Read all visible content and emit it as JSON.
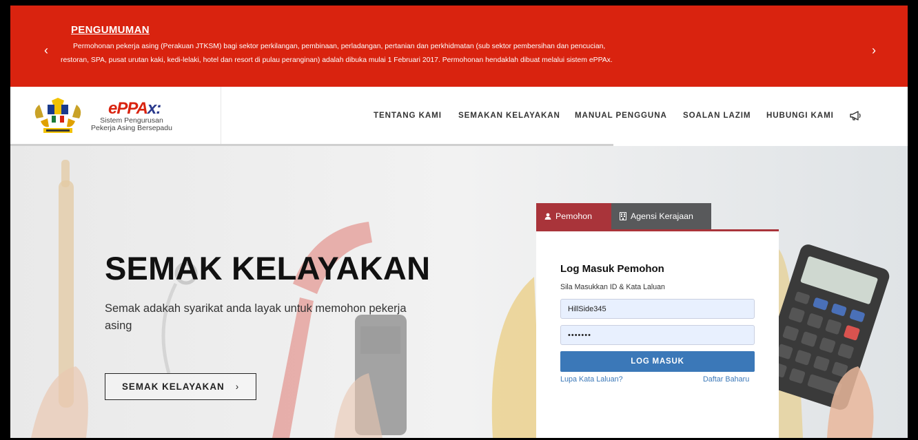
{
  "announcement": {
    "title": "PENGUMUMAN",
    "line1": "Permohonan pekerja asing (Perakuan JTKSM) bagi sektor perkilangan, pembinaan, perladangan, pertanian dan perkhidmatan (sub sektor pembersihan dan pencucian,",
    "line2": "restoran, SPA, pusat urutan kaki, kedi-lelaki, hotel dan resort di pulau peranginan) adalah dibuka mulai 1 Februari 2017. Permohonan hendaklah dibuat melalui sistem ePPAx.",
    "prev_icon": "chevron-left-icon",
    "next_icon": "chevron-right-icon",
    "color": "#d9230f"
  },
  "brand": {
    "logo_main": "ePPA",
    "logo_suffix": "x:",
    "subtitle_line1": "Sistem Pengurusan",
    "subtitle_line2": "Pekerja Asing Bersepadu",
    "crest_icon": "malaysia-coat-of-arms-icon"
  },
  "nav": {
    "items": [
      "TENTANG KAMI",
      "SEMAKAN KELAYAKAN",
      "MANUAL PENGGUNA",
      "SOALAN LAZIM",
      "HUBUNGI KAMI"
    ],
    "announce_icon": "megaphone-icon"
  },
  "hero": {
    "title": "SEMAK KELAYAKAN",
    "description": "Semak adakah syarikat anda layak untuk memohon pekerja asing",
    "cta_label": "SEMAK KELAYAKAN",
    "cta_icon": "chevron-right-icon"
  },
  "login": {
    "tabs": [
      {
        "label": "Pemohon",
        "icon": "user-icon",
        "active": true
      },
      {
        "label": "Agensi Kerajaan",
        "icon": "building-icon",
        "active": false
      }
    ],
    "title": "Log Masuk Pemohon",
    "hint": "Sila Masukkan ID & Kata Laluan",
    "username_value": "HillSide345",
    "password_value": "•••••••",
    "button_label": "LOG MASUK",
    "forgot_label": "Lupa Kata Laluan?",
    "signup_label": "Daftar Baharu",
    "accent_color": "#a9343a",
    "button_color": "#3b78b8"
  }
}
